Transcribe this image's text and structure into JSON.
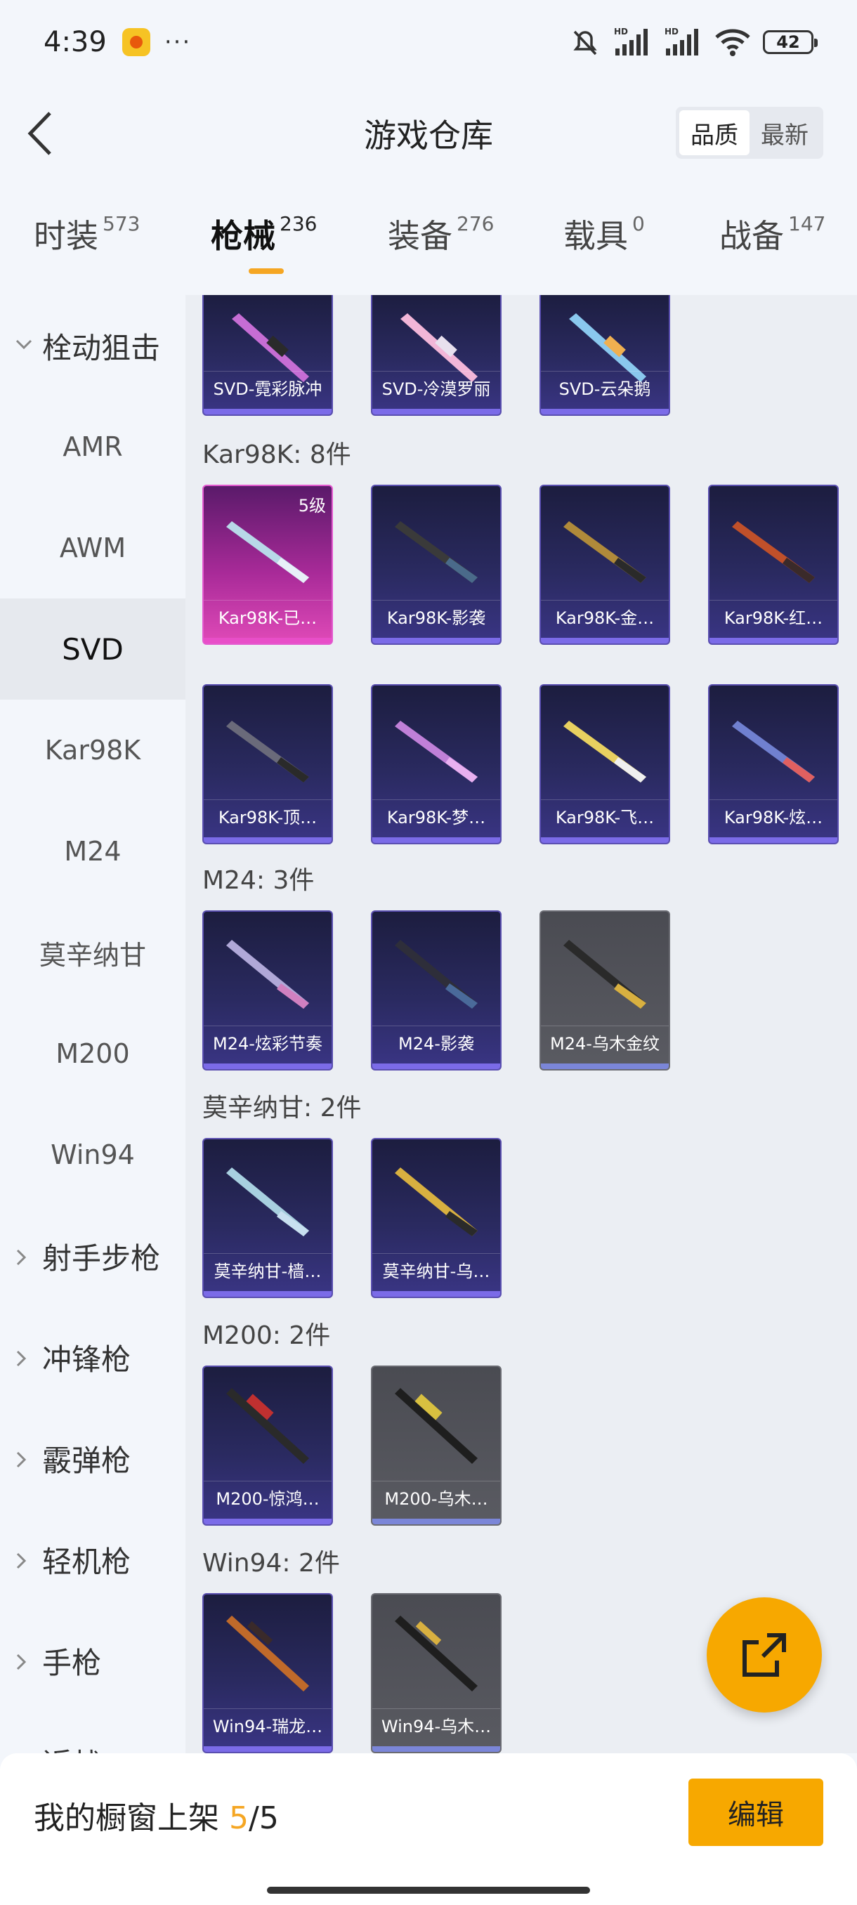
{
  "status_bar": {
    "time": "4:39",
    "more": "···",
    "battery": "42",
    "icons": [
      "app-notification-icon",
      "mute-icon",
      "signal-hd-icon",
      "signal-hd-icon",
      "wifi-icon",
      "battery-icon"
    ]
  },
  "header": {
    "title": "游戏仓库",
    "sort_options": [
      "品质",
      "最新"
    ],
    "sort_selected": "品质"
  },
  "tabs": [
    {
      "label": "时装",
      "count": "573"
    },
    {
      "label": "枪械",
      "count": "236",
      "active": true
    },
    {
      "label": "装备",
      "count": "276"
    },
    {
      "label": "载具",
      "count": "0"
    },
    {
      "label": "战备",
      "count": "147"
    }
  ],
  "sidebar": {
    "group_open": "栓动狙击",
    "subitems": [
      "AMR",
      "AWM",
      "SVD",
      "Kar98K",
      "M24",
      "莫辛纳甘",
      "M200",
      "Win94"
    ],
    "selected": "SVD",
    "groups": [
      "射手步枪",
      "冲锋枪",
      "霰弹枪",
      "轻机枪",
      "手枪",
      "近战"
    ]
  },
  "content": {
    "svd_cards": [
      "SVD-霓彩脉冲",
      "SVD-冷漠罗丽",
      "SVD-云朵鹅"
    ],
    "kar98k": {
      "title": "Kar98K: 8件",
      "cards": [
        "Kar98K-已…",
        "Kar98K-影袭",
        "Kar98K-金…",
        "Kar98K-红…",
        "Kar98K-顶…",
        "Kar98K-梦…",
        "Kar98K-飞…",
        "Kar98K-炫…"
      ],
      "badge": "5级"
    },
    "m24": {
      "title": "M24: 3件",
      "cards": [
        "M24-炫彩节奏",
        "M24-影袭",
        "M24-乌木金纹"
      ]
    },
    "mosin": {
      "title": "莫辛纳甘: 2件",
      "cards": [
        "莫辛纳甘-樯…",
        "莫辛纳甘-乌…"
      ]
    },
    "m200": {
      "title": "M200: 2件",
      "cards": [
        "M200-惊鸿…",
        "M200-乌木…"
      ]
    },
    "win94": {
      "title": "Win94: 2件",
      "cards": [
        "Win94-瑞龙…",
        "Win94-乌木…"
      ]
    }
  },
  "bottom": {
    "showcase_prefix": "我的橱窗上架 ",
    "showcase_current": "5",
    "showcase_total": "/5",
    "edit_label": "编辑"
  },
  "colors": {
    "accent": "#f7a800",
    "card_purple": "#2a2a60",
    "card_pink": "#e04ab8",
    "card_gray": "#5a5b62"
  }
}
